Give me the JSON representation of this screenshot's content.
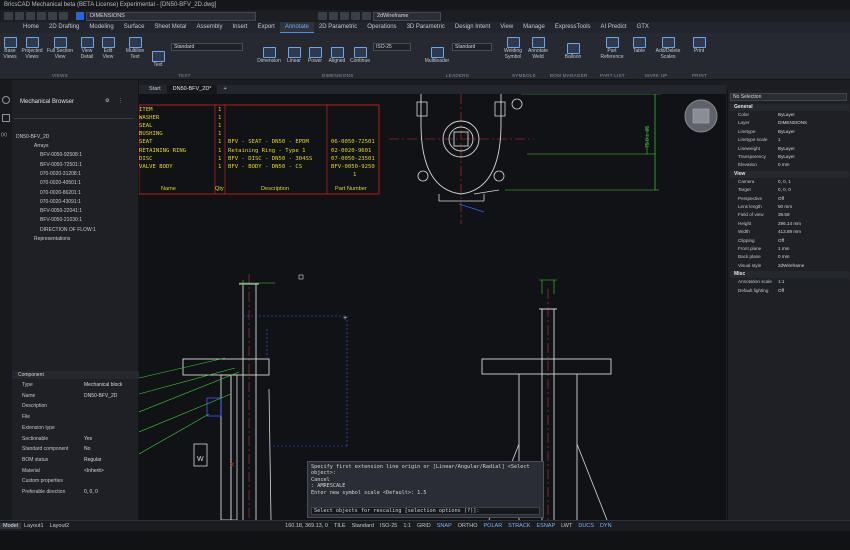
{
  "window": {
    "title": "BricsCAD Mechanical beta (BETA License) Experimental - [DN50-BFV_2D.dwg]"
  },
  "quick_access": {
    "layer": "DIMENSIONS",
    "visual_style": "2dWireframe"
  },
  "tabs": [
    "Home",
    "2D Drafting",
    "Modeling",
    "Surface",
    "Sheet Metal",
    "Assembly",
    "Insert",
    "Export",
    "Annotate",
    "2D Parametric",
    "Operations",
    "3D Parametric",
    "Design Intent",
    "View",
    "Manage",
    "ExpressTools",
    "AI Predict",
    "GTX"
  ],
  "active_tab": "Annotate",
  "ribbon": {
    "views_buttons": [
      "Base Views",
      "Projected Views",
      "Full Section View",
      "View Detail",
      "Edit View",
      "Multiline Text"
    ],
    "text_button": "Text",
    "text_style": "Standard",
    "dim_buttons": [
      "Dimension",
      "Linear",
      "Power",
      "Aligned",
      "Continue"
    ],
    "dim_style": "ISO-25",
    "multileader": "Multileader",
    "mleader_style": "Standard",
    "symbol_buttons": [
      "Welding Symbol",
      "Annotate Weld"
    ],
    "balloon": "Balloon",
    "part_buttons": [
      "Part Reference",
      "Table",
      "Add/Delete Scales"
    ],
    "print": "Print",
    "groups": [
      "VIEWS",
      "TEXT",
      "DIMENSIONS",
      "LEADERS",
      "SYMBOLS",
      "BOM MANAGER",
      "PART LIST",
      "MARK UP",
      "PRINT"
    ]
  },
  "browser": {
    "title": "Mechanical Browser",
    "root": "DN50-BFV_2D",
    "items": [
      "Arrays",
      "BFV-0050-92508:1",
      "BFV-0050-72501:1",
      "070-0020-31208:1",
      "070-0020-40501:1",
      "070-0020-86201:1",
      "070-0020-43091:1",
      "BFV-0050-22041:1",
      "BFV-0050-21030:1",
      "DIRECTION OF FLOW:1",
      "Representations"
    ]
  },
  "component": {
    "header": "Component",
    "rows": [
      {
        "k": "Type",
        "v": "Mechanical block"
      },
      {
        "k": "Name",
        "v": "DN50-BFV_2D"
      },
      {
        "k": "Description",
        "v": ""
      },
      {
        "k": "File",
        "v": ""
      },
      {
        "k": "Extension type",
        "v": ""
      },
      {
        "k": "Sectionable",
        "v": "Yes"
      },
      {
        "k": "Standard component",
        "v": "No"
      },
      {
        "k": "BOM status",
        "v": "Regular"
      },
      {
        "k": "Material",
        "v": "<Inherit>"
      },
      {
        "k": "Custom properties",
        "v": ""
      },
      {
        "k": "Preferable direction",
        "v": "0, 0, 0"
      }
    ]
  },
  "doc_tabs": [
    "Start",
    "DN50-BFV_2D*"
  ],
  "bom_table": {
    "rows": [
      {
        "item": "ITEM",
        "qty": "1",
        "desc": "",
        "part": ""
      },
      {
        "item": "WASHER",
        "qty": "1",
        "desc": "",
        "part": ""
      },
      {
        "item": "SEAL",
        "qty": "1",
        "desc": "",
        "part": ""
      },
      {
        "item": "BUSHING",
        "qty": "1",
        "desc": "",
        "part": ""
      },
      {
        "item": "SEAT",
        "qty": "1",
        "desc": "BFV - SEAT - DN50 - EPDM",
        "part": "06-0050-72501"
      },
      {
        "item": "RETAINING RING",
        "qty": "1",
        "desc": "Retaining Ring - Type 1",
        "part": "02-0020-9601"
      },
      {
        "item": "DISC",
        "qty": "1",
        "desc": "BFV - DISC - DN50 - 304SS",
        "part": "07-0050-23501"
      },
      {
        "item": "VALVE BODY",
        "qty": "1",
        "desc": "BFV - BODY - DN50 - CS",
        "part": "BFV-0050-9250"
      }
    ],
    "last_qty": "1",
    "headers": [
      "Name",
      "Qty",
      "Description",
      "Part Number"
    ]
  },
  "properties": {
    "selection": "No Selection",
    "sections": [
      {
        "name": "General",
        "rows": [
          {
            "k": "Color",
            "v": "ByLayer"
          },
          {
            "k": "Layer",
            "v": "DIMENSIONS"
          },
          {
            "k": "Linetype",
            "v": "ByLayer"
          },
          {
            "k": "Linetype scale",
            "v": "1"
          },
          {
            "k": "Lineweight",
            "v": "ByLayer"
          },
          {
            "k": "Transparency",
            "v": "ByLayer"
          },
          {
            "k": "Elevation",
            "v": "0 mm"
          }
        ]
      },
      {
        "name": "View",
        "rows": [
          {
            "k": "Camera",
            "v": "0, 0, 1"
          },
          {
            "k": "Target",
            "v": "0, 0, 0"
          },
          {
            "k": "Perspective",
            "v": "Off"
          },
          {
            "k": "Lens length",
            "v": "50 mm"
          },
          {
            "k": "Field of view",
            "v": "39.59"
          },
          {
            "k": "Height",
            "v": "296.14 mm"
          },
          {
            "k": "Width",
            "v": "413.89 mm"
          },
          {
            "k": "Clipping",
            "v": "Off"
          },
          {
            "k": "Front plane",
            "v": "1 mm"
          },
          {
            "k": "Back plane",
            "v": "0 mm"
          },
          {
            "k": "Visual style",
            "v": "2dWireframe"
          }
        ]
      },
      {
        "name": "Misc",
        "rows": [
          {
            "k": "Annotation scale",
            "v": "1:1"
          },
          {
            "k": "Default lighting",
            "v": "Off"
          }
        ]
      }
    ]
  },
  "command_history": [
    "Specify first extension line origin or [Linear/Angular/Radial] <Select",
    "object>:",
    "Cancel",
    ": AMRESCALE",
    "Enter new symbol scale <Default>: 1.5"
  ],
  "command_prompt": "Select objects for rescaling [selection options (?)]:",
  "status": {
    "layout_tabs": [
      "Model",
      "Layout1",
      "Layout2"
    ],
    "coords": "160.18, 369.13, 0",
    "items": [
      "TILE",
      "Standard",
      "ISO-25",
      "1:1",
      "GRID",
      "SNAP",
      "ORTHO",
      "POLAR",
      "STRACK",
      "ESNAP",
      "LWT",
      "DUCS",
      "DYN"
    ],
    "on_items": [
      "SNAP",
      "POLAR",
      "STRACK",
      "ESNAP",
      "DUCS",
      "DYN"
    ]
  },
  "drawing_labels": {
    "w_tag": "W",
    "dim_vertical": "75.0 ± .05"
  },
  "colors": {
    "accent": "#4d8fe6",
    "bom_red": "#e0231f",
    "bom_yellow": "#e4d820",
    "dim_green": "#3fd13a",
    "center_red": "#c83232",
    "dim_blue": "#3b5cff"
  }
}
